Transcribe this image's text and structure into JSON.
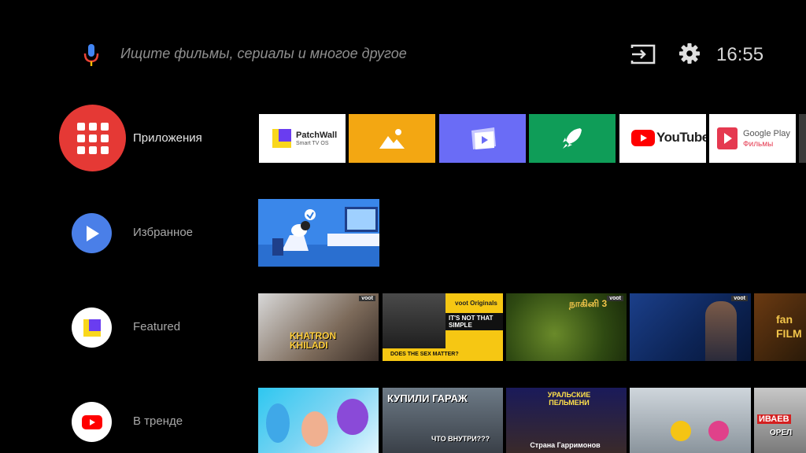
{
  "search": {
    "placeholder": "Ищите фильмы, сериалы и многое другое"
  },
  "status": {
    "time": "16:55"
  },
  "icons": {
    "mic": "microphone-icon",
    "input": "input-source-icon",
    "settings": "gear-icon"
  },
  "colors": {
    "apps_red": "#e53935",
    "favorite_blue": "#4a7fe8",
    "youtube_red": "#ff0000",
    "yellow": "#f3a712",
    "purple": "#6a6cf6",
    "green": "#0f9d58"
  },
  "rows": [
    {
      "label": "Приложения"
    },
    {
      "label": "Избранное"
    },
    {
      "label": "Featured"
    },
    {
      "label": "В тренде"
    }
  ],
  "apps": [
    {
      "name": "PatchWall",
      "sub": "Smart TV OS"
    },
    {
      "name": "gallery",
      "icon": "image-icon"
    },
    {
      "name": "video",
      "icon": "play-folder-icon"
    },
    {
      "name": "launcher",
      "icon": "rocket-icon"
    },
    {
      "name": "YouTube"
    },
    {
      "name": "Google Play",
      "sub": "Фильмы"
    }
  ],
  "featured": [
    {
      "badge": "voot",
      "title": "KHATRON KHILADI"
    },
    {
      "badge": "voot Originals",
      "title": "IT'S NOT THAT SIMPLE",
      "caption": "DOES THE SEX MATTER?"
    },
    {
      "badge": "voot",
      "title": "நாகினி 3"
    },
    {
      "badge": "voot",
      "title": ""
    },
    {
      "title": "fan FILM"
    }
  ],
  "trending": [
    {
      "title": ""
    },
    {
      "title": "КУПИЛИ ГАРАЖ",
      "caption": "ЧТО ВНУТРИ???"
    },
    {
      "title": "УРАЛЬСКИЕ ПЕЛЬМЕНИ",
      "caption": "Страна Гарримонов"
    },
    {
      "title": ""
    },
    {
      "title": "ИВАЕВ",
      "caption": "ОРЕЛ"
    }
  ]
}
